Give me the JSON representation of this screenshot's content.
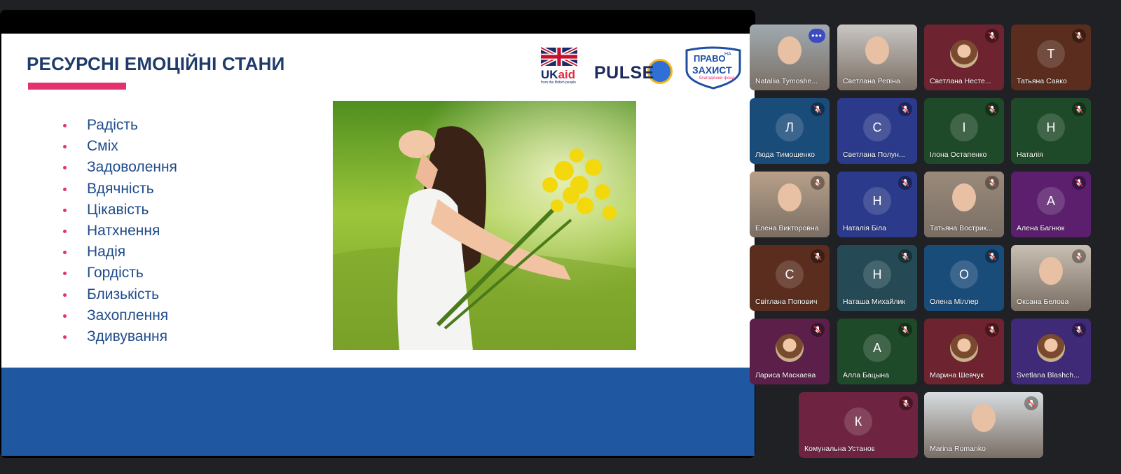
{
  "slide": {
    "title": "РЕСУРСНІ ЕМОЦІЙНІ СТАНИ",
    "emotions": [
      "Радість",
      "Сміх",
      "Задоволення",
      "Вдячність",
      "Цікавість",
      "Натхнення",
      "Надія",
      "Гордість",
      "Близькість",
      "Захоплення",
      "Здивування"
    ],
    "logos": {
      "ukaid_main_uk": "UK",
      "ukaid_main_aid": "aid",
      "ukaid_sub": "from the British people",
      "pulse": "PULSE",
      "pravo_line1": "ПРАВО",
      "pravo_na": "НА",
      "pravo_line2": "ЗАХИСТ",
      "pravo_line3": "благодійний фонд"
    }
  },
  "participants": [
    {
      "name": "Nataliia Tymoshe...",
      "initial": "",
      "color": "#a0aab0",
      "type": "video",
      "mic": "more"
    },
    {
      "name": "Светлана Репіна",
      "initial": "",
      "color": "#c9c6c4",
      "type": "video",
      "mic": "none"
    },
    {
      "name": "Светлана Несте...",
      "initial": "",
      "color": "#6e2430",
      "type": "photo",
      "mic": "muted"
    },
    {
      "name": "Татьяна Савко",
      "initial": "Т",
      "color": "#5a2d1e",
      "type": "initial",
      "mic": "muted"
    },
    {
      "name": "Люда Тимошенко",
      "initial": "Л",
      "color": "#1a4c7a",
      "type": "initial",
      "mic": "muted"
    },
    {
      "name": "Светлана Полун...",
      "initial": "С",
      "color": "#2b3a8a",
      "type": "initial",
      "mic": "muted"
    },
    {
      "name": "Ілона Остапенко",
      "initial": "І",
      "color": "#1f4a2a",
      "type": "initial",
      "mic": "muted"
    },
    {
      "name": "Наталія",
      "initial": "Н",
      "color": "#1f4a2a",
      "type": "initial",
      "mic": "muted"
    },
    {
      "name": "Елена Викторовна",
      "initial": "",
      "color": "#b8a08a",
      "type": "video",
      "mic": "muted"
    },
    {
      "name": "Наталія Біла",
      "initial": "Н",
      "color": "#2b3a8a",
      "type": "initial",
      "mic": "muted"
    },
    {
      "name": "Татьяна Вострик...",
      "initial": "",
      "color": "#9a8a7a",
      "type": "video",
      "mic": "muted"
    },
    {
      "name": "Алена Багнюк",
      "initial": "А",
      "color": "#5b1f6e",
      "type": "initial",
      "mic": "muted"
    },
    {
      "name": "Світлана Попович",
      "initial": "С",
      "color": "#5a2d1e",
      "type": "initial",
      "mic": "muted"
    },
    {
      "name": "Наташа Михайлик",
      "initial": "Н",
      "color": "#254a55",
      "type": "initial",
      "mic": "muted"
    },
    {
      "name": "Олена Міллер",
      "initial": "О",
      "color": "#1a4c7a",
      "type": "initial",
      "mic": "muted"
    },
    {
      "name": "Оксана Белова",
      "initial": "",
      "color": "#c8bfb2",
      "type": "video",
      "mic": "muted"
    },
    {
      "name": "Лариса Маскаева",
      "initial": "",
      "color": "#5b1f4a",
      "type": "photo",
      "mic": "muted"
    },
    {
      "name": "Алла Бацына",
      "initial": "А",
      "color": "#1f4a2a",
      "type": "initial",
      "mic": "muted"
    },
    {
      "name": "Марина Шевчук",
      "initial": "",
      "color": "#6e2430",
      "type": "photo",
      "mic": "muted"
    },
    {
      "name": "Svetlana Blashch...",
      "initial": "",
      "color": "#3f2a78",
      "type": "photo",
      "mic": "muted"
    },
    {
      "name": "Комунальна Установа",
      "initial": "К",
      "color": "#6e2440",
      "type": "initial",
      "mic": "muted"
    },
    {
      "name": "Marina Romanko",
      "initial": "",
      "color": "#d7dde0",
      "type": "video",
      "mic": "muted"
    }
  ],
  "icons": {
    "muted": "mic-off-icon",
    "more": "more-options-icon"
  }
}
